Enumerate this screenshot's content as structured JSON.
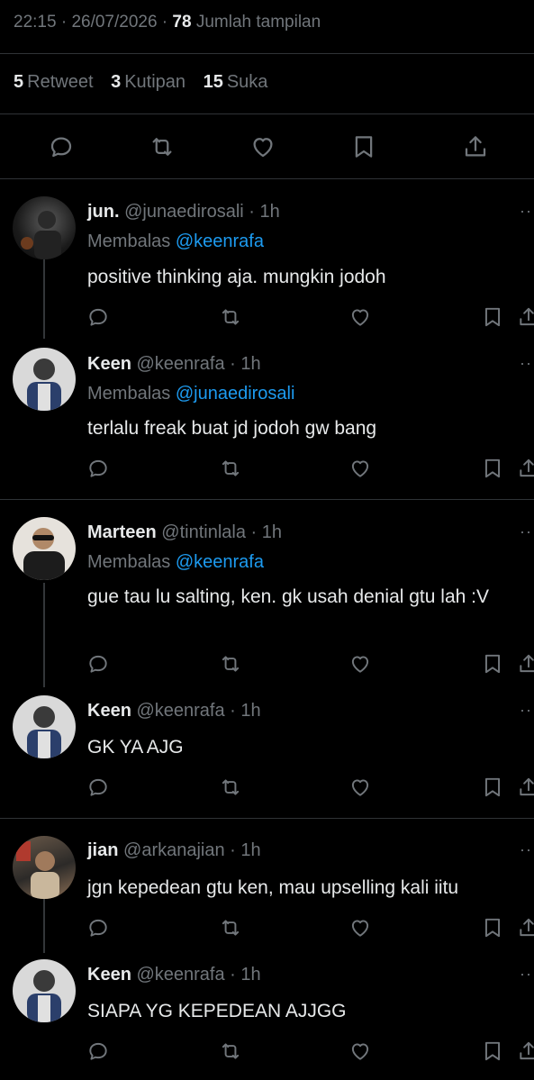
{
  "meta": {
    "time": "22:15",
    "date": "26/07/2026",
    "views": "78",
    "views_label": "Jumlah tampilan"
  },
  "stats": {
    "retweet_count": "5",
    "retweet_label": "Retweet",
    "quote_count": "3",
    "quote_label": "Kutipan",
    "like_count": "15",
    "like_label": "Suka"
  },
  "reply_prefix": "Membalas",
  "more": "··",
  "replies": [
    {
      "name": "jun.",
      "handle": "@junaedirosali",
      "time": "1h",
      "replying_to": "@keenrafa",
      "text": "positive thinking aja. mungkin jodoh"
    },
    {
      "name": "Keen",
      "handle": "@keenrafa",
      "time": "1h",
      "replying_to": "@junaedirosali",
      "text": "terlalu freak buat jd jodoh gw bang"
    },
    {
      "name": "Marteen",
      "handle": "@tintinlala",
      "time": "1h",
      "replying_to": "@keenrafa",
      "text": "gue tau lu salting, ken. gk usah denial gtu lah :V"
    },
    {
      "name": "Keen",
      "handle": "@keenrafa",
      "time": "1h",
      "text": "GK YA AJG"
    },
    {
      "name": "jian",
      "handle": "@arkanajian",
      "time": "1h",
      "text": "jgn kepedean gtu ken, mau upselling kali iitu"
    },
    {
      "name": "Keen",
      "handle": "@keenrafa",
      "time": "1h",
      "text": "SIAPA YG KEPEDEAN AJJGG"
    }
  ]
}
